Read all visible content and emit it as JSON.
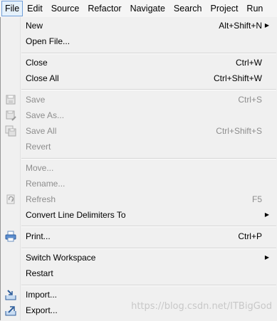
{
  "menubar": {
    "items": [
      "File",
      "Edit",
      "Source",
      "Refactor",
      "Navigate",
      "Search",
      "Project",
      "Run"
    ]
  },
  "file_menu": {
    "new": {
      "label": "New",
      "shortcut": "Alt+Shift+N"
    },
    "open_file": {
      "label": "Open File..."
    },
    "close": {
      "label": "Close",
      "shortcut": "Ctrl+W"
    },
    "close_all": {
      "label": "Close All",
      "shortcut": "Ctrl+Shift+W"
    },
    "save": {
      "label": "Save",
      "shortcut": "Ctrl+S"
    },
    "save_as": {
      "label": "Save As..."
    },
    "save_all": {
      "label": "Save All",
      "shortcut": "Ctrl+Shift+S"
    },
    "revert": {
      "label": "Revert"
    },
    "move": {
      "label": "Move..."
    },
    "rename": {
      "label": "Rename..."
    },
    "refresh": {
      "label": "Refresh",
      "shortcut": "F5"
    },
    "convert": {
      "label": "Convert Line Delimiters To"
    },
    "print": {
      "label": "Print...",
      "shortcut": "Ctrl+P"
    },
    "switch_workspace": {
      "label": "Switch Workspace"
    },
    "restart": {
      "label": "Restart"
    },
    "import": {
      "label": "Import..."
    },
    "export": {
      "label": "Export..."
    }
  },
  "watermark": "https://blog.csdn.net/ITBigGod"
}
